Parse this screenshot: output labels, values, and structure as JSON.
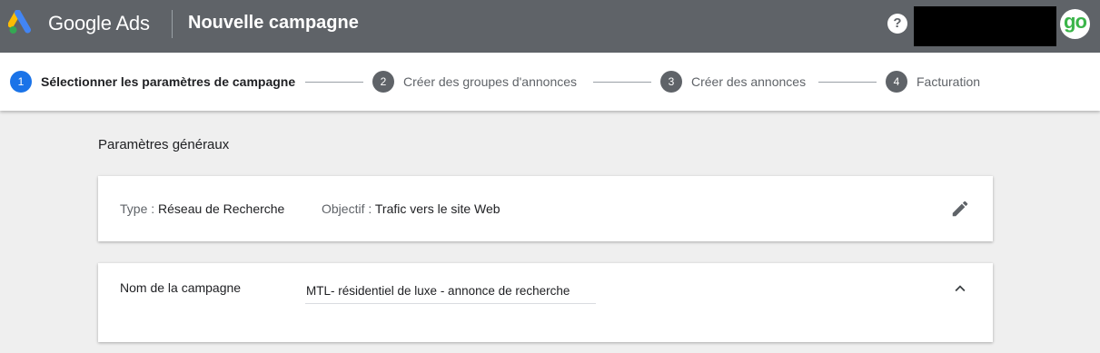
{
  "header": {
    "brand": "Google Ads",
    "title": "Nouvelle campagne",
    "help_label": "?",
    "avatar_text": "go",
    "colors": {
      "bar": "#5f6368",
      "logo_blue": "#4285f4",
      "logo_yellow": "#fbbc04",
      "logo_green": "#34a853",
      "avatar_green": "#3bb54a"
    }
  },
  "stepper": {
    "steps": [
      {
        "number": "1",
        "label": "Sélectionner les paramètres de campagne",
        "active": true
      },
      {
        "number": "2",
        "label": "Créer des groupes d'annonces",
        "active": false
      },
      {
        "number": "3",
        "label": "Créer des annonces",
        "active": false
      },
      {
        "number": "4",
        "label": "Facturation",
        "active": false
      }
    ],
    "active_color": "#1a73e8"
  },
  "main": {
    "section_title": "Paramètres généraux",
    "summary": {
      "type_label": "Type : ",
      "type_value": "Réseau de Recherche",
      "objective_label": "Objectif : ",
      "objective_value": "Trafic vers le site Web",
      "edit_icon": "pencil-icon"
    },
    "campaign_name": {
      "label": "Nom de la campagne",
      "value": "MTL- résidentiel de luxe - annonce de recherche",
      "collapse_icon": "chevron-up-icon"
    }
  }
}
